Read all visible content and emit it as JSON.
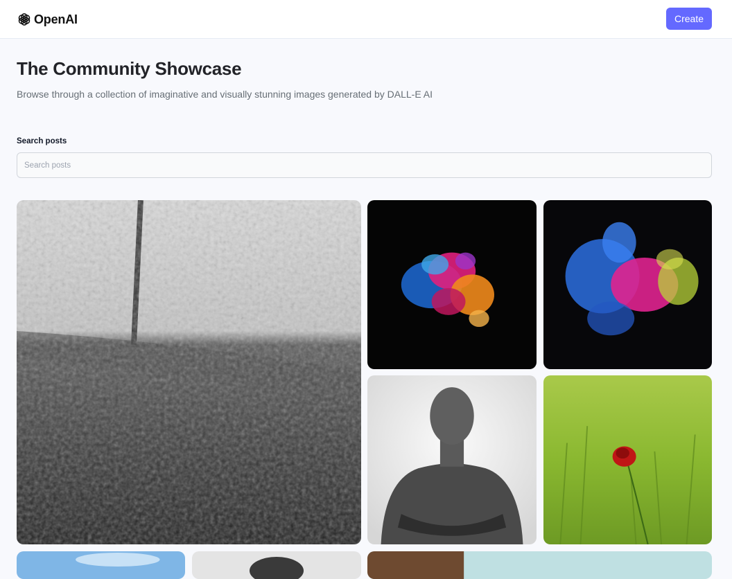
{
  "header": {
    "logo_text": "OpenAI",
    "create_label": "Create"
  },
  "main": {
    "title": "The Community Showcase",
    "subtitle": "Browse through a collection of imaginative and visually stunning images generated by DALL-E AI",
    "search": {
      "label": "Search posts",
      "placeholder": "Search posts",
      "value": ""
    }
  },
  "colors": {
    "accent": "#6469ff",
    "background": "#f8f9fd",
    "title": "#222328",
    "subtitle": "#666e75"
  }
}
